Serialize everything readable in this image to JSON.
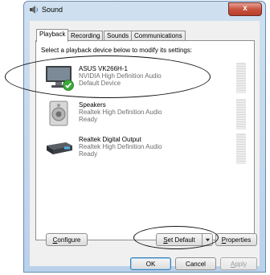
{
  "window": {
    "title": "Sound",
    "close_glyph": "x"
  },
  "tabs": [
    {
      "label": "Playback",
      "active": true
    },
    {
      "label": "Recording",
      "active": false
    },
    {
      "label": "Sounds",
      "active": false
    },
    {
      "label": "Communications",
      "active": false
    }
  ],
  "panel": {
    "instruction": "Select a playback device below to modify its settings:"
  },
  "devices": [
    {
      "name": "ASUS VK266H-1",
      "description": "NVIDIA High Definition Audio",
      "status": "Default Device",
      "icon": "monitor-icon",
      "is_default": true
    },
    {
      "name": "Speakers",
      "description": "Realtek High Definition Audio",
      "status": "Ready",
      "icon": "speaker-icon",
      "is_default": false
    },
    {
      "name": "Realtek Digital Output",
      "description": "Realtek High Definition Audio",
      "status": "Ready",
      "icon": "digital-output-icon",
      "is_default": false
    }
  ],
  "buttons": {
    "configure": {
      "prefix": "",
      "accel": "C",
      "rest": "onfigure"
    },
    "set_default": {
      "prefix": "",
      "accel": "S",
      "rest": "et Default"
    },
    "properties": {
      "prefix": "",
      "accel": "P",
      "rest": "roperties"
    },
    "ok": "OK",
    "cancel": "Cancel",
    "apply": {
      "prefix": "",
      "accel": "A",
      "rest": "pply"
    }
  },
  "colors": {
    "accent_green": "#3aa83a",
    "title_bar": "#b9d1ea",
    "close_red": "#c8533f"
  }
}
